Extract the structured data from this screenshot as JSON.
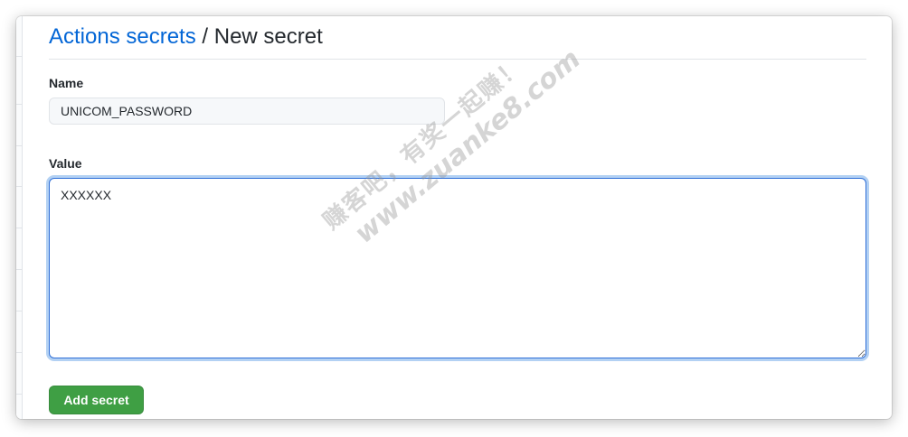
{
  "header": {
    "breadcrumb_link": "Actions secrets",
    "separator": " / ",
    "title": "New secret"
  },
  "form": {
    "name_label": "Name",
    "name_value": "UNICOM_PASSWORD",
    "value_label": "Value",
    "value_text": "XXXXXX",
    "submit_label": "Add secret"
  },
  "watermark": {
    "line1": "赚客吧，有奖一起赚！",
    "line2": "www.zuanke8.com"
  },
  "colors": {
    "link": "#0366d6",
    "button_bg": "#3f9f44",
    "focus_border": "#2f6fd8"
  }
}
